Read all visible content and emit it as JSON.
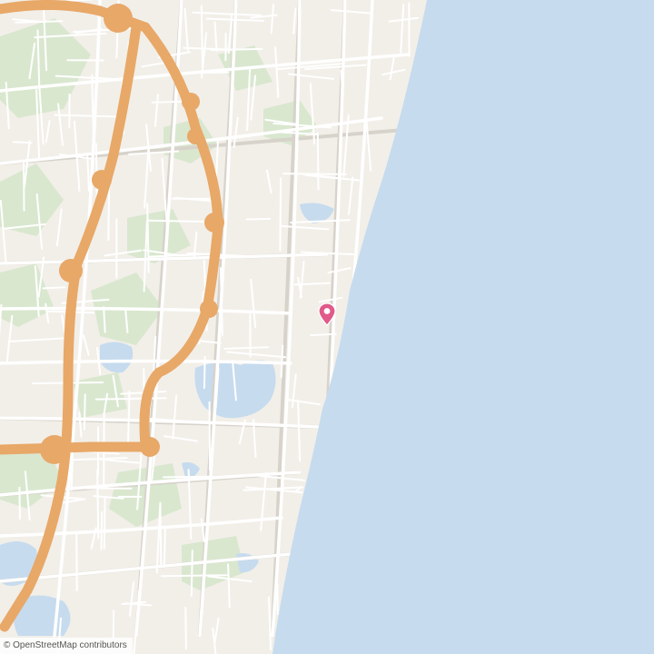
{
  "map": {
    "attribution": {
      "symbol": "©",
      "text": "OpenStreetMap contributors"
    },
    "colors": {
      "land": "#f2efe9",
      "water": "#c6dbee",
      "park": "#d8e8cf",
      "road_minor": "#ffffff",
      "road_casing": "#d6d2ca",
      "motorway": "#e8a868",
      "marker": "#e05a8a"
    },
    "marker": {
      "icon": "map-pin-icon"
    }
  }
}
